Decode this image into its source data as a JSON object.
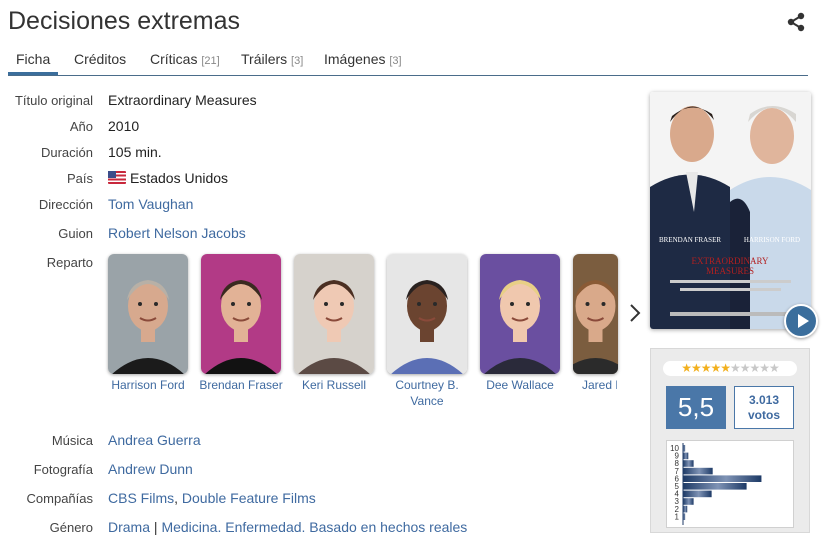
{
  "page": {
    "title": "Decisiones extremas"
  },
  "tabs": [
    {
      "label": "Ficha",
      "count": ""
    },
    {
      "label": "Créditos",
      "count": ""
    },
    {
      "label": "Críticas",
      "count": "[21]"
    },
    {
      "label": "Tráilers",
      "count": "[3]"
    },
    {
      "label": "Imágenes",
      "count": "[3]"
    }
  ],
  "details": {
    "original_title": {
      "label": "Título original",
      "value": "Extraordinary Measures"
    },
    "year": {
      "label": "Año",
      "value": "2010"
    },
    "duration": {
      "label": "Duración",
      "value": "105 min."
    },
    "country": {
      "label": "País",
      "value": "Estados Unidos"
    },
    "direction": {
      "label": "Dirección",
      "value": "Tom Vaughan"
    },
    "script": {
      "label": "Guion",
      "value": "Robert Nelson Jacobs"
    },
    "cast_label": "Reparto",
    "music": {
      "label": "Música",
      "value": "Andrea Guerra"
    },
    "photography": {
      "label": "Fotografía",
      "value": "Andrew Dunn"
    },
    "companies": {
      "label": "Compañías",
      "values": [
        "CBS Films",
        "Double Feature Films"
      ]
    },
    "genre": {
      "label": "Género",
      "values": [
        "Drama",
        "Medicina. Enfermedad. Basado en hechos reales"
      ]
    }
  },
  "cast": [
    {
      "name": "Harrison Ford",
      "bg": "#9aa3a8",
      "skin": "#d7a98e",
      "hair": "#b8b0a6",
      "shirt": "#1b1b1b"
    },
    {
      "name": "Brendan Fraser",
      "bg": "#b23a86",
      "skin": "#e2b296",
      "hair": "#3a2a20",
      "shirt": "#121212"
    },
    {
      "name": "Keri Russell",
      "bg": "#d6d2cc",
      "skin": "#efc9b4",
      "hair": "#4b2f22",
      "shirt": "#5b4a44"
    },
    {
      "name": "Courtney B. Vance",
      "bg": "#e6e6e6",
      "skin": "#6b4430",
      "hair": "#2a2220",
      "shirt": "#5b6fb5"
    },
    {
      "name": "Dee Wallace",
      "bg": "#6a4fa0",
      "skin": "#f0c8ae",
      "hair": "#e8cf86",
      "shirt": "#2a2a3a"
    },
    {
      "name": "Jared Harris",
      "bg": "#7b5d3f",
      "skin": "#d9a98a",
      "hair": "#8a5a35",
      "shirt": "#2b2b2b"
    }
  ],
  "poster": {
    "actor1": "BRENDAN FRASER",
    "actor2": "HARRISON FORD",
    "title_line1": "EXTRAORDINARY",
    "title_line2": "MEASURES"
  },
  "rating": {
    "stars_filled": "★★★★★",
    "stars_empty": "★★★★★",
    "score": "5,5",
    "votes_count": "3.013",
    "votes_label": "votos",
    "distribution": [
      {
        "score": "10",
        "fraction": 0.02
      },
      {
        "score": "9",
        "fraction": 0.05
      },
      {
        "score": "8",
        "fraction": 0.1
      },
      {
        "score": "7",
        "fraction": 0.28
      },
      {
        "score": "6",
        "fraction": 0.74
      },
      {
        "score": "5",
        "fraction": 0.6
      },
      {
        "score": "4",
        "fraction": 0.27
      },
      {
        "score": "3",
        "fraction": 0.1
      },
      {
        "score": "2",
        "fraction": 0.04
      },
      {
        "score": "1",
        "fraction": 0.02
      }
    ]
  }
}
